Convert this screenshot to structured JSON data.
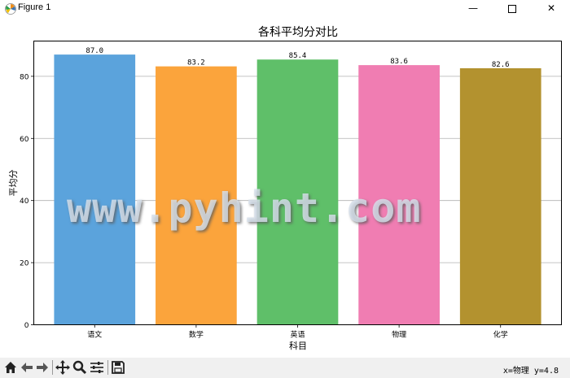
{
  "window": {
    "title": "Figure 1"
  },
  "toolbar": {
    "icons": [
      "home-icon",
      "back-icon",
      "forward-icon",
      "pan-icon",
      "zoom-icon",
      "subplots-icon",
      "save-icon"
    ],
    "coord_readout": "x=物理 y=4.8"
  },
  "watermark": {
    "text": "www.pyhint.com"
  },
  "chart_data": {
    "type": "bar",
    "title": "各科平均分对比",
    "xlabel": "科目",
    "ylabel": "平均分",
    "categories": [
      "语文",
      "数学",
      "英语",
      "物理",
      "化学"
    ],
    "values": [
      87.0,
      83.2,
      85.4,
      83.6,
      82.6
    ],
    "value_labels": [
      "87.0",
      "83.2",
      "85.4",
      "83.6",
      "82.6"
    ],
    "colors": [
      "#5ba3dc",
      "#fba43c",
      "#5fbf69",
      "#f07db2",
      "#b3922f"
    ],
    "ylim": [
      0,
      91.35
    ],
    "yticks": [
      0,
      20,
      40,
      60,
      80
    ],
    "grid": "y",
    "legend": "none"
  }
}
